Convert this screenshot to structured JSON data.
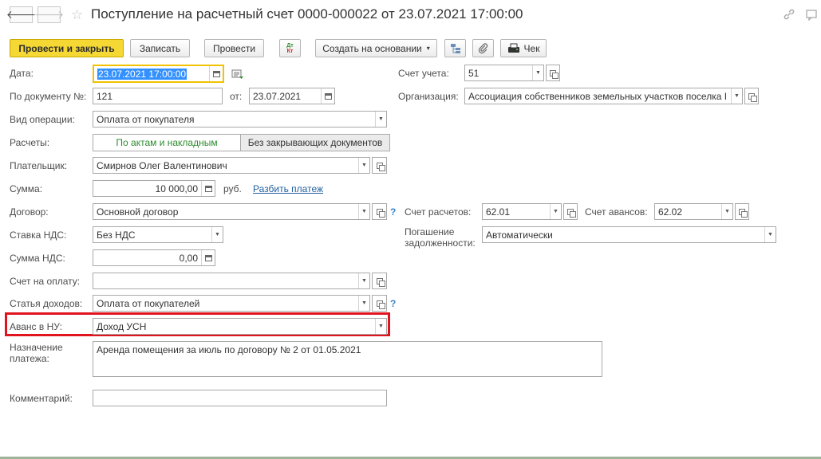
{
  "window": {
    "title": "Поступление на расчетный счет 0000-000022 от 23.07.2021 17:00:00",
    "nav_back": "🡐",
    "nav_forward": "🡒",
    "star": "☆"
  },
  "toolbar": {
    "post_close": "Провести и закрыть",
    "save": "Записать",
    "post": "Провести",
    "dt_kt_top": "Дт",
    "dt_kt_bottom": "Кт",
    "create_based": "Создать на основании",
    "check": "Чек",
    "dropdown_arrow": "▾"
  },
  "form": {
    "date_label": "Дата:",
    "date_value": "23.07.2021 17:00:00",
    "doc_num_label": "По документу №:",
    "doc_num_value": "121",
    "from_label": "от:",
    "from_value": "23.07.2021",
    "operation_label": "Вид операции:",
    "operation_value": "Оплата от покупателя",
    "settlements_label": "Расчеты:",
    "settlements_option1": "По актам и накладным",
    "settlements_option2": "Без закрывающих документов",
    "payer_label": "Плательщик:",
    "payer_value": "Смирнов Олег Валентинович",
    "sum_label": "Сумма:",
    "sum_value": "10 000,00",
    "currency": "руб.",
    "split_link": "Разбить платеж",
    "contract_label": "Договор:",
    "contract_value": "Основной договор",
    "vat_rate_label": "Ставка НДС:",
    "vat_rate_value": "Без НДС",
    "vat_sum_label": "Сумма НДС:",
    "vat_sum_value": "0,00",
    "invoice_label": "Счет на оплату:",
    "invoice_value": "",
    "income_label": "Статья доходов:",
    "income_value": "Оплата от покупателей",
    "advance_label": "Аванс в НУ:",
    "advance_value": "Доход УСН",
    "purpose_label_1": "Назначение",
    "purpose_label_2": "платежа:",
    "purpose_value": "Аренда помещения за июль по договору № 2 от 01.05.2021",
    "comment_label": "Комментарий:",
    "comment_value": "",
    "account_label": "Счет учета:",
    "account_value": "51",
    "org_label": "Организация:",
    "org_value": "Ассоциация собственников земельных участков поселка I",
    "settl_account_label": "Счет расчетов:",
    "settl_account_value": "62.01",
    "adv_account_label": "Счет авансов:",
    "adv_account_value": "62.02",
    "debt_label_1": "Погашение",
    "debt_label_2": "задолженности:",
    "debt_value": "Автоматически",
    "help": "?"
  },
  "colors": {
    "primary_button": "#f5d833",
    "highlight_box": "#e0141e",
    "link": "#1f5f9f",
    "selected_segment_text": "#2e8b2e"
  },
  "icons": [
    "back-arrow-icon",
    "forward-arrow-icon",
    "star-icon",
    "link-icon",
    "more-icon",
    "dt-kt-icon",
    "structure-icon",
    "paperclip-icon",
    "check-print-icon",
    "calendar-icon",
    "open-icon",
    "dropdown-icon",
    "list-icon"
  ]
}
